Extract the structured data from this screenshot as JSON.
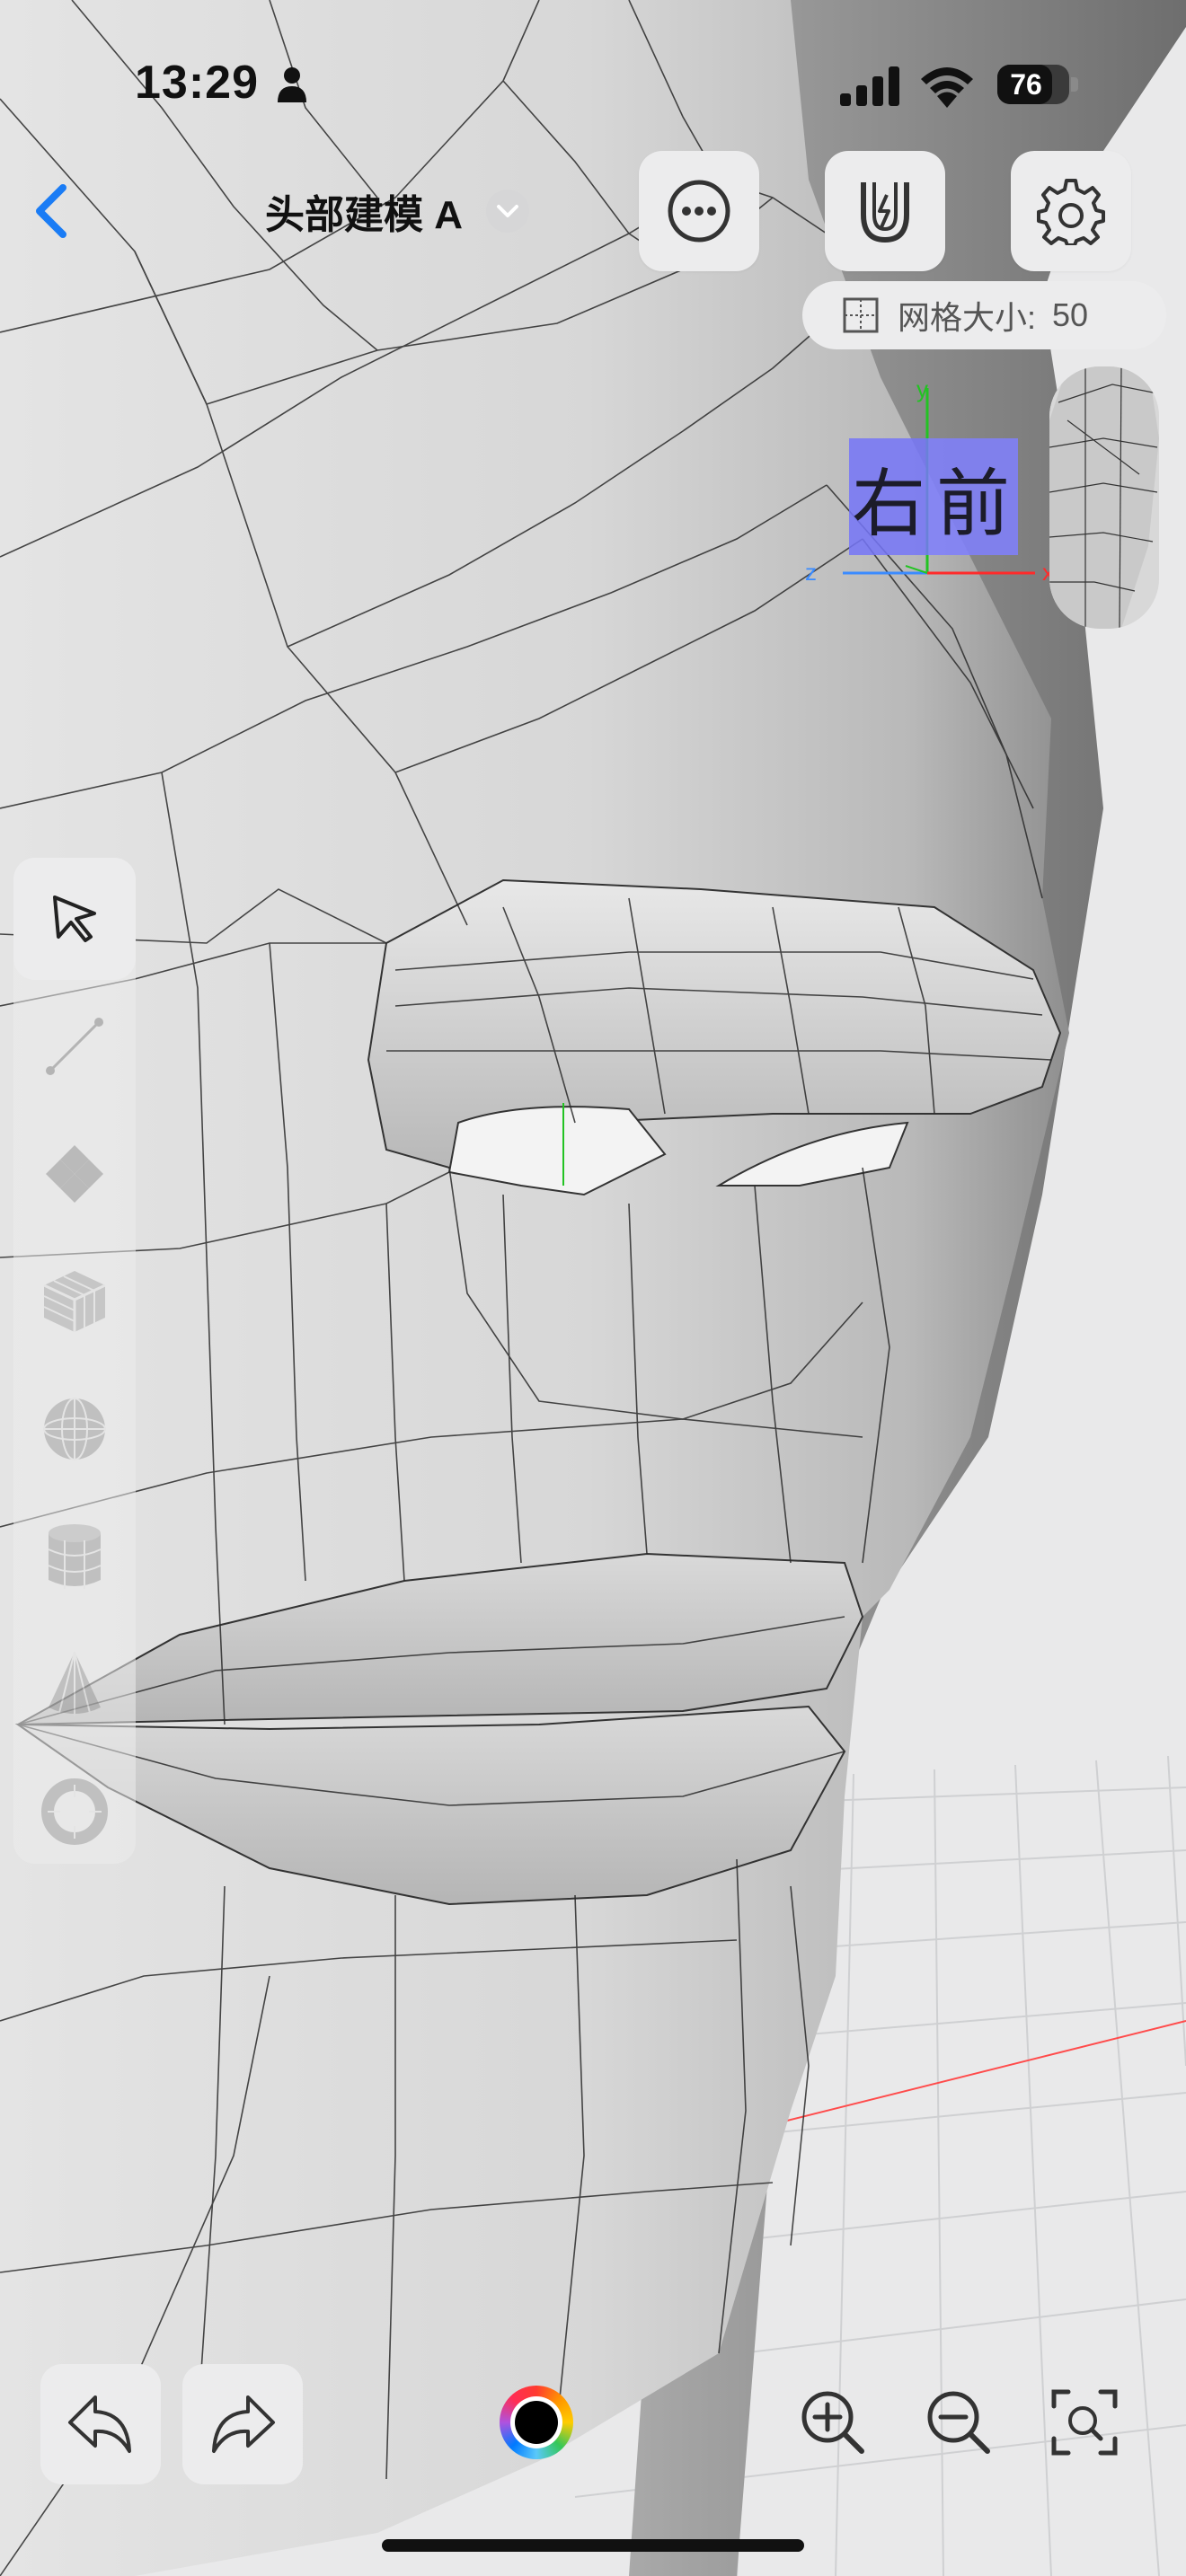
{
  "status_bar": {
    "time": "13:29",
    "battery_percent": "76",
    "battery_level": 0.76
  },
  "header": {
    "title": "头部建模 A"
  },
  "grid": {
    "label": "网格大小:",
    "value": "50"
  },
  "view_cube": {
    "right_face": "右",
    "front_face": "前",
    "axis_y": "y",
    "axis_z": "z",
    "axis_x": "x",
    "colors": {
      "face": "#7676f8",
      "x_axis": "#ff2a2a",
      "y_axis": "#22c322",
      "z_axis": "#3a8bff"
    }
  },
  "side_toolbar": {
    "tools": [
      {
        "icon": "select-arrow-icon",
        "state": "active"
      },
      {
        "icon": "line-icon",
        "state": "disabled"
      },
      {
        "icon": "plane-icon",
        "state": "disabled"
      },
      {
        "icon": "cube-icon",
        "state": "disabled"
      },
      {
        "icon": "sphere-icon",
        "state": "disabled"
      },
      {
        "icon": "cylinder-icon",
        "state": "disabled"
      },
      {
        "icon": "cone-icon",
        "state": "disabled"
      },
      {
        "icon": "torus-icon",
        "state": "disabled"
      }
    ]
  },
  "bottom_bar": {
    "current_color": "#000000",
    "icons": [
      "undo-icon",
      "redo-icon",
      "color-wheel-icon",
      "zoom-in-icon",
      "zoom-out-icon",
      "fit-view-icon"
    ]
  },
  "theme": {
    "accent": "#1a7cf5",
    "background": "#e9e9ea",
    "button_bg": "#ececed"
  }
}
